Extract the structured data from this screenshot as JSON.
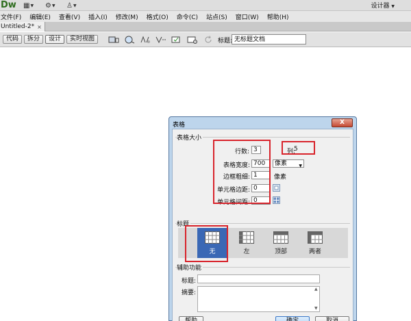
{
  "app": {
    "logo": "Dw",
    "workspace_label": "设计器",
    "top_tool_icons": [
      "layout-icon",
      "gear-icon",
      "extensions-icon"
    ]
  },
  "menu": [
    "文件(F)",
    "编辑(E)",
    "查看(V)",
    "插入(I)",
    "修改(M)",
    "格式(O)",
    "命令(C)",
    "站点(S)",
    "窗口(W)",
    "帮助(H)"
  ],
  "document_tab": {
    "name": "Untitled-2*",
    "close": "×"
  },
  "doc_toolbar": {
    "views": [
      "代码",
      "拆分",
      "设计",
      "实时视图"
    ],
    "active_view": "设计",
    "title_label": "标题:",
    "title_value": "无标题文档"
  },
  "dialog": {
    "title": "表格",
    "close": "X",
    "size_section": "表格大小",
    "rows_label": "行数:",
    "rows_value": "3",
    "cols_label": "列:",
    "cols_value": "5",
    "width_label": "表格宽度:",
    "width_value": "700",
    "width_unit": "像素",
    "border_label": "边框粗细:",
    "border_value": "1",
    "border_unit": "像素",
    "padding_label": "单元格边距:",
    "padding_value": "0",
    "spacing_label": "单元格间距:",
    "spacing_value": "0",
    "header_section": "标题",
    "header_options": [
      "无",
      "左",
      "顶部",
      "两者"
    ],
    "header_selected": "无",
    "accessibility_section": "辅助功能",
    "caption_label": "标题:",
    "caption_value": "",
    "summary_label": "摘要:",
    "summary_value": "",
    "help_button": "帮助",
    "ok_button": "确定",
    "cancel_button": "取消"
  },
  "colors": {
    "annotation_red": "#d8222a",
    "selected_header_blue": "#3a68b5",
    "dialog_frame": "#bdd5ec"
  }
}
